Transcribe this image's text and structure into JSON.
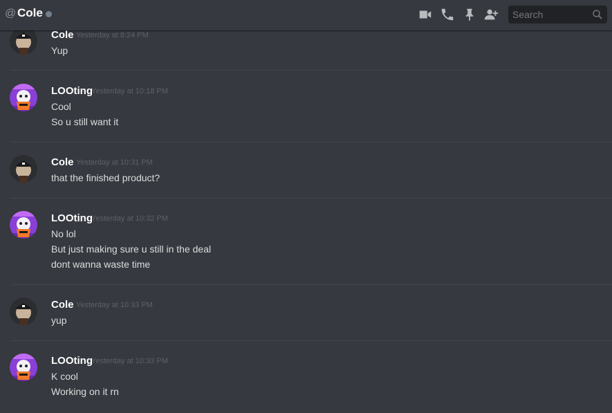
{
  "header": {
    "at_symbol": "@",
    "channel_name": "Cole",
    "search_placeholder": "Search"
  },
  "colors": {
    "background": "#36393f",
    "header_text": "#ffffff",
    "status_offline": "#747f8d",
    "timestamp": "#5e6167"
  },
  "messages": [
    {
      "user": "Cole",
      "timestamp": "Yesterday at 8:24 PM",
      "lines": [
        "Yup"
      ],
      "avatar": "cole-avatar"
    },
    {
      "user": "LOOting",
      "timestamp": "Yesterday at 10:18 PM",
      "lines": [
        "Cool",
        "So u still want it"
      ],
      "avatar": "looting-avatar"
    },
    {
      "user": "Cole",
      "timestamp": "Yesterday at 10:31 PM",
      "lines": [
        "that the finished product?"
      ],
      "avatar": "cole-avatar"
    },
    {
      "user": "LOOting",
      "timestamp": "Yesterday at 10:32 PM",
      "lines": [
        "No lol",
        "But just making sure u still in the deal",
        "dont wanna waste time"
      ],
      "avatar": "looting-avatar"
    },
    {
      "user": "Cole",
      "timestamp": "Yesterday at 10:33 PM",
      "lines": [
        "yup"
      ],
      "avatar": "cole-avatar"
    },
    {
      "user": "LOOting",
      "timestamp": "Yesterday at 10:33 PM",
      "lines": [
        "K cool",
        "Working on it rn"
      ],
      "avatar": "looting-avatar"
    }
  ]
}
